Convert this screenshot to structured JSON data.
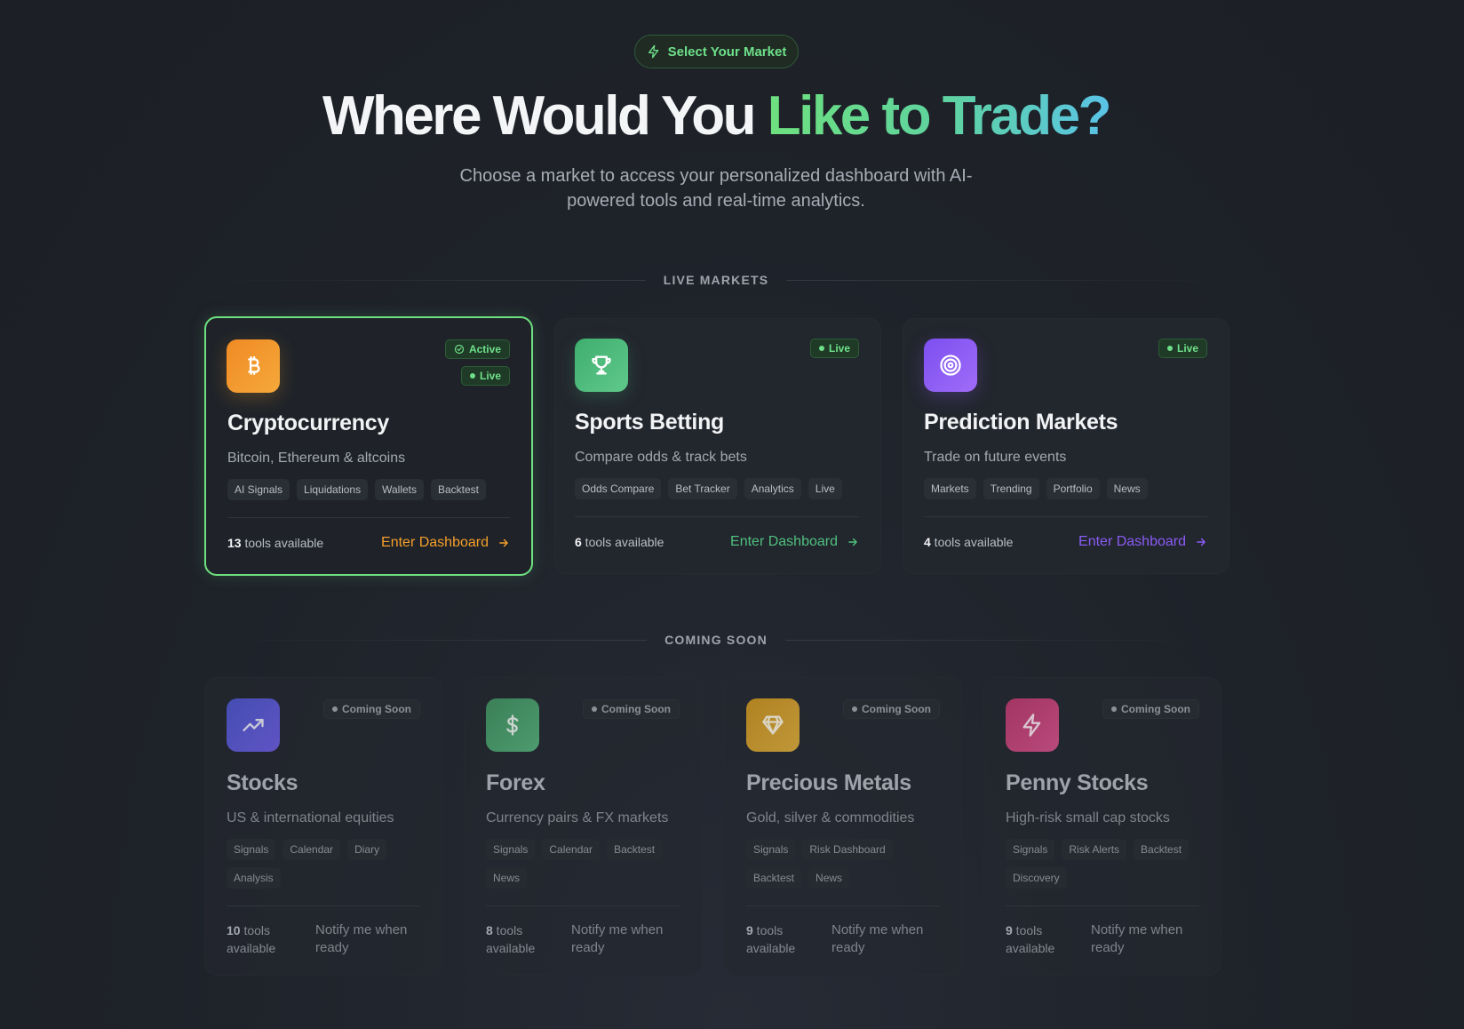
{
  "hero": {
    "pill_label": "Select Your Market",
    "title_plain": "Where Would You ",
    "title_highlight": "Like to Trade?",
    "subtitle": "Choose a market to access your personalized dashboard with AI-powered tools and real-time analytics."
  },
  "sections": {
    "live": "LIVE MARKETS",
    "soon": "COMING SOON"
  },
  "live_markets": [
    {
      "title": "Cryptocurrency",
      "desc": "Bitcoin, Ethereum & altcoins",
      "tags": [
        "AI Signals",
        "Liquidations",
        "Wallets",
        "Backtest"
      ],
      "tools_count": "13",
      "tools_label": " tools available",
      "cta": "Enter Dashboard",
      "badge_active": "Active",
      "badge_live": "Live",
      "accent": "#f59e2a",
      "icon": "bitcoin-icon"
    },
    {
      "title": "Sports Betting",
      "desc": "Compare odds & track bets",
      "tags": [
        "Odds Compare",
        "Bet Tracker",
        "Analytics",
        "Live"
      ],
      "tools_count": "6",
      "tools_label": " tools available",
      "cta": "Enter Dashboard",
      "badge_live": "Live",
      "accent": "#4fc07f",
      "icon": "trophy-icon"
    },
    {
      "title": "Prediction Markets",
      "desc": "Trade on future events",
      "tags": [
        "Markets",
        "Trending",
        "Portfolio",
        "News"
      ],
      "tools_count": "4",
      "tools_label": " tools available",
      "cta": "Enter Dashboard",
      "badge_live": "Live",
      "accent": "#8b5cf6",
      "icon": "target-icon"
    }
  ],
  "coming_soon": [
    {
      "title": "Stocks",
      "desc": "US & international equities",
      "tags": [
        "Signals",
        "Calendar",
        "Diary",
        "Analysis"
      ],
      "tools_count": "10",
      "tools_label": " tools available",
      "notify": "Notify me when ready",
      "badge": "Coming Soon",
      "icon": "trending-up-icon"
    },
    {
      "title": "Forex",
      "desc": "Currency pairs & FX markets",
      "tags": [
        "Signals",
        "Calendar",
        "Backtest",
        "News"
      ],
      "tools_count": "8",
      "tools_label": " tools available",
      "notify": "Notify me when ready",
      "badge": "Coming Soon",
      "icon": "dollar-icon"
    },
    {
      "title": "Precious Metals",
      "desc": "Gold, silver & commodities",
      "tags": [
        "Signals",
        "Risk Dashboard",
        "Backtest",
        "News"
      ],
      "tools_count": "9",
      "tools_label": " tools available",
      "notify": "Notify me when ready",
      "badge": "Coming Soon",
      "icon": "diamond-icon"
    },
    {
      "title": "Penny Stocks",
      "desc": "High-risk small cap stocks",
      "tags": [
        "Signals",
        "Risk Alerts",
        "Backtest",
        "Discovery"
      ],
      "tools_count": "9",
      "tools_label": " tools available",
      "notify": "Notify me when ready",
      "badge": "Coming Soon",
      "icon": "lightning-icon"
    }
  ]
}
